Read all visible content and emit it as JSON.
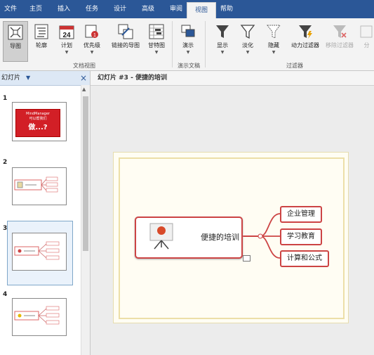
{
  "tabs": [
    {
      "label": "文件",
      "active": false
    },
    {
      "label": "主页",
      "active": false
    },
    {
      "label": "插入",
      "active": false
    },
    {
      "label": "任务",
      "active": false
    },
    {
      "label": "设计",
      "active": false
    },
    {
      "label": "高级",
      "active": false
    },
    {
      "label": "审阅",
      "active": false
    },
    {
      "label": "视图",
      "active": true
    },
    {
      "label": "帮助",
      "active": false
    }
  ],
  "ribbon": {
    "groups": [
      {
        "label": "文档视图",
        "buttons": [
          {
            "label": "导图",
            "icon": "map-view-icon",
            "selected": true,
            "dropdown": false
          },
          {
            "label": "轮廓",
            "icon": "outline-icon",
            "selected": false,
            "dropdown": false
          },
          {
            "label": "计划",
            "icon": "calendar-icon",
            "selected": false,
            "dropdown": true,
            "icon_text": "24"
          },
          {
            "label": "优先级",
            "icon": "priority-icon",
            "selected": false,
            "dropdown": true
          },
          {
            "label": "链接的导图",
            "icon": "linked-maps-icon",
            "selected": false,
            "dropdown": false
          },
          {
            "label": "甘特图",
            "icon": "gantt-icon",
            "selected": false,
            "dropdown": true
          }
        ]
      },
      {
        "label": "演示文稿",
        "buttons": [
          {
            "label": "演示",
            "icon": "present-icon",
            "selected": false,
            "dropdown": true
          }
        ]
      },
      {
        "label": "过滤器",
        "buttons": [
          {
            "label": "显示",
            "icon": "filter-show-icon",
            "selected": false,
            "dropdown": true
          },
          {
            "label": "淡化",
            "icon": "filter-fade-icon",
            "selected": false,
            "dropdown": true
          },
          {
            "label": "隐藏",
            "icon": "filter-hide-icon",
            "selected": false,
            "dropdown": true
          },
          {
            "label": "动力过滤器",
            "icon": "power-filter-icon",
            "selected": false,
            "dropdown": false
          },
          {
            "label": "移除过滤器",
            "icon": "remove-filter-icon",
            "selected": false,
            "dropdown": false,
            "disabled": true
          },
          {
            "label": "分",
            "icon": "split-icon",
            "selected": false,
            "dropdown": false,
            "disabled": true
          }
        ]
      }
    ]
  },
  "slides_panel": {
    "title": "幻灯片",
    "slides": [
      {
        "number": "1",
        "brand": "MindManager",
        "line2": "可以帮我们",
        "line3": "做...?"
      },
      {
        "number": "2"
      },
      {
        "number": "3",
        "selected": true
      },
      {
        "number": "4"
      }
    ]
  },
  "main": {
    "title": "幻灯片 #3 - 便捷的培训",
    "central_topic": "便捷的培训",
    "subtopics": [
      "企业管理",
      "学习教育",
      "计算和公式"
    ]
  },
  "colors": {
    "accent": "#2b5797",
    "topic_border": "#cc4444"
  }
}
